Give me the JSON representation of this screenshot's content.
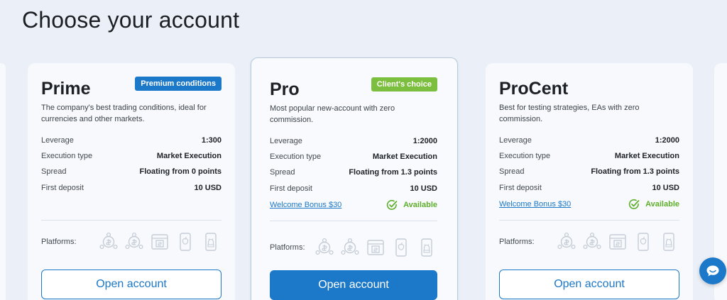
{
  "page": {
    "title": "Choose your account"
  },
  "colors": {
    "accent": "#1c78c8",
    "premium_badge": "#1c78c8",
    "choice_badge": "#7cbe3d",
    "available": "#5fae2b"
  },
  "spec_labels": {
    "leverage": "Leverage",
    "execution": "Execution type",
    "spread": "Spread",
    "deposit": "First deposit"
  },
  "platforms_label": "Platforms:",
  "platform_icons": [
    "mt4-icon",
    "mt5-icon",
    "web-terminal-icon",
    "ios-app-icon",
    "android-app-icon"
  ],
  "cards": [
    {
      "name": "Prime",
      "badge": "Premium conditions",
      "description": "The company's best trading conditions, ideal for currencies and other markets.",
      "leverage": "1:300",
      "execution": "Market Execution",
      "spread": "Floating from 0 points",
      "deposit": "10 USD",
      "button": "Open account"
    },
    {
      "name": "Pro",
      "badge": "Client's choice",
      "description": "Most popular new-account with zero commission.",
      "leverage": "1:2000",
      "execution": "Market Execution",
      "spread": "Floating from 1.3 points",
      "deposit": "10 USD",
      "bonus_link": "Welcome Bonus $30",
      "bonus_status": "Available",
      "button": "Open account"
    },
    {
      "name": "ProCent",
      "description": "Best for testing strategies, EAs with zero commission.",
      "leverage": "1:2000",
      "execution": "Market Execution",
      "spread": "Floating from 1.3 points",
      "deposit": "10 USD",
      "bonus_link": "Welcome Bonus $30",
      "bonus_status": "Available",
      "button": "Open account"
    }
  ],
  "chat": {
    "icon": "chat-bubble-icon"
  }
}
